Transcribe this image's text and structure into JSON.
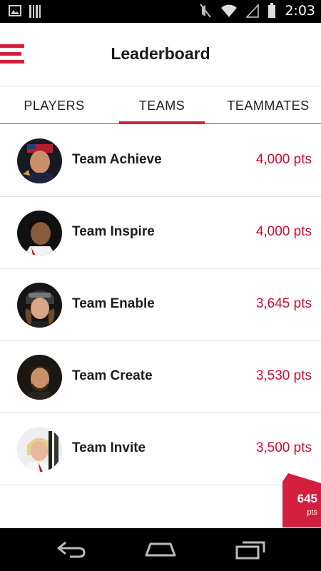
{
  "status_bar": {
    "time": "2:03",
    "icons": [
      "image-icon",
      "barcode-icon",
      "mute-icon",
      "wifi-icon",
      "signal-icon",
      "battery-icon"
    ]
  },
  "header": {
    "title": "Leaderboard",
    "menu_icon": "hamburger-menu-icon"
  },
  "tabs": [
    {
      "label": "PLAYERS",
      "active": false
    },
    {
      "label": "TEAMS",
      "active": true
    },
    {
      "label": "TEAMMATES",
      "active": false
    }
  ],
  "teams": [
    {
      "name": "Team Achieve",
      "points": "4,000 pts"
    },
    {
      "name": "Team Inspire",
      "points": "4,000 pts"
    },
    {
      "name": "Team Enable",
      "points": "3,645 pts"
    },
    {
      "name": "Team Create",
      "points": "3,530 pts"
    },
    {
      "name": "Team Invite",
      "points": "3,500 pts"
    }
  ],
  "score_badge": {
    "value": "645",
    "unit": "pts"
  },
  "nav_bar": {
    "icons": [
      "back-icon",
      "home-icon",
      "recents-icon"
    ]
  },
  "colors": {
    "accent": "#d31f3d",
    "points": "#c8102e"
  }
}
